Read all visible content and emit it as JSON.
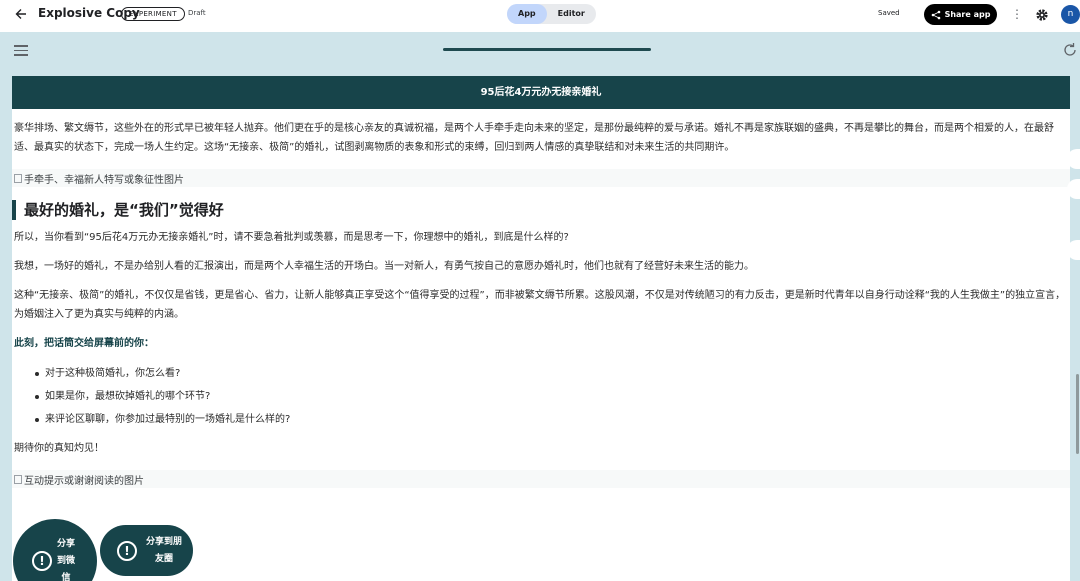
{
  "header": {
    "app_title": "Explosive Copy",
    "badge": "EXPERIMENT",
    "status": "Draft",
    "tabs": [
      "App",
      "Editor"
    ],
    "save_state": "Saved",
    "share_label": "Share app",
    "avatar_initial": "n"
  },
  "article": {
    "banner_title": "95后花4万元办无接亲婚礼",
    "intro": "豪华排场、繁文缛节，这些外在的形式早已被年轻人抛弃。他们更在乎的是核心亲友的真诚祝福，是两个人手牵手走向未来的坚定，是那份最纯粹的爱与承诺。婚礼不再是家族联姻的盛典，不再是攀比的舞台，而是两个相爱的人，在最舒适、最真实的状态下，完成一场人生约定。这场“无接亲、极简”的婚礼，试图剥离物质的表象和形式的束缚，回归到两人情感的真挚联结和对未来生活的共同期许。",
    "image1_alt": "手牵手、幸福新人特写或象征性图片",
    "heading": "最好的婚礼，是“我们”觉得好",
    "para2": "所以，当你看到“95后花4万元办无接亲婚礼”时，请不要急着批判或羡慕，而是思考一下，你理想中的婚礼，到底是什么样的?",
    "para3": "我想，一场好的婚礼，不是办给别人看的汇报演出，而是两个人幸福生活的开场白。当一对新人，有勇气按自己的意愿办婚礼时，他们也就有了经营好未来生活的能力。",
    "para4": "这种“无接亲、极简”的婚礼，不仅仅是省钱，更是省心、省力，让新人能够真正享受这个“值得享受的过程”，而非被繁文缛节所累。这股风潮，不仅是对传统陋习的有力反击，更是新时代青年以自身行动诠释“我的人生我做主”的独立宣言，为婚姻注入了更为真实与纯粹的内涵。",
    "cta_heading": "此刻，把话筒交给屏幕前的你：",
    "questions": [
      "对于这种极简婚礼，你怎么看?",
      "如果是你，最想砍掉婚礼的哪个环节?",
      "来评论区聊聊，你参加过最特别的一场婚礼是什么样的?"
    ],
    "closing": "期待你的真知灼见！",
    "image2_alt": "互动提示或谢谢阅读的图片"
  },
  "actions": {
    "share_wechat": "分享到微信",
    "share_moments": "分享到朋友圈"
  },
  "colors": {
    "accent": "#17444a",
    "frame_bg": "#cfe4ea",
    "tab_active": "#c2d6fb",
    "avatar": "#1a56a7"
  }
}
